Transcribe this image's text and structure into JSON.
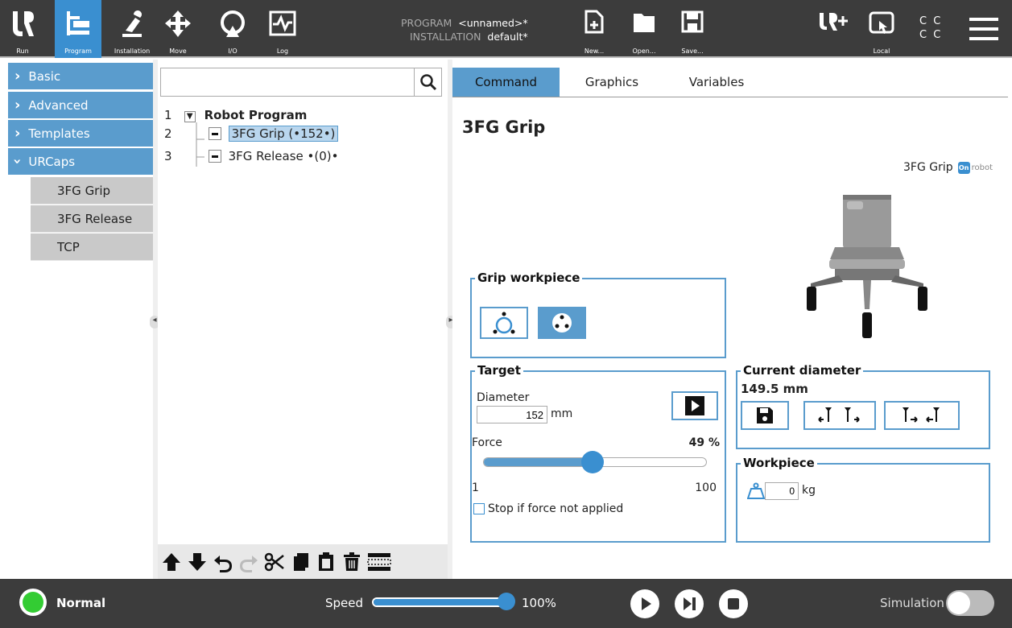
{
  "topbar": {
    "nav": [
      {
        "label": "Run",
        "icon": "ur-logo-icon"
      },
      {
        "label": "Program",
        "icon": "program-icon"
      },
      {
        "label": "Installation",
        "icon": "installation-icon"
      },
      {
        "label": "Move",
        "icon": "move-icon"
      },
      {
        "label": "I/O",
        "icon": "io-icon"
      },
      {
        "label": "Log",
        "icon": "log-icon"
      }
    ],
    "program_label": "PROGRAM",
    "program_value": "<unnamed>*",
    "installation_label": "INSTALLATION",
    "installation_value": "default*",
    "file": [
      {
        "label": "New...",
        "icon": "new-file-icon"
      },
      {
        "label": "Open...",
        "icon": "open-folder-icon"
      },
      {
        "label": "Save...",
        "icon": "save-icon"
      }
    ],
    "local_label": "Local",
    "cc_text": "C C"
  },
  "sidebar": {
    "categories": [
      {
        "label": "Basic",
        "expanded": false
      },
      {
        "label": "Advanced",
        "expanded": false
      },
      {
        "label": "Templates",
        "expanded": false
      },
      {
        "label": "URCaps",
        "expanded": true
      }
    ],
    "subitems": [
      "3FG Grip",
      "3FG Release",
      "TCP"
    ]
  },
  "tree": {
    "search_placeholder": "",
    "lines": [
      {
        "num": "1",
        "label": "Robot Program"
      },
      {
        "num": "2",
        "label": "3FG Grip (•152•)"
      },
      {
        "num": "3",
        "label": "3FG Release •(0)•"
      }
    ]
  },
  "tabs": [
    "Command",
    "Graphics",
    "Variables"
  ],
  "command": {
    "title": "3FG Grip",
    "brand_label": "3FG Grip",
    "brand_logo": "robot",
    "logo_mark": "On",
    "grip_workpiece_label": "Grip workpiece",
    "target_label": "Target",
    "diameter_label": "Diameter",
    "diameter_value": "152",
    "diameter_unit": "mm",
    "force_label": "Force",
    "force_value": "49 %",
    "force_fraction": 0.49,
    "force_min": "1",
    "force_max": "100",
    "stop_label": "Stop if force not applied",
    "current_diameter_label": "Current diameter",
    "current_diameter_value": "149.5 mm",
    "workpiece_label": "Workpiece",
    "workpiece_value": "0",
    "workpiece_unit": "kg"
  },
  "bottombar": {
    "status": "Normal",
    "speed_label": "Speed",
    "speed_value": "100%",
    "speed_fraction": 1.0,
    "simulation_label": "Simulation",
    "status_color": "#33cc33",
    "accent": "#5a9ccd"
  }
}
